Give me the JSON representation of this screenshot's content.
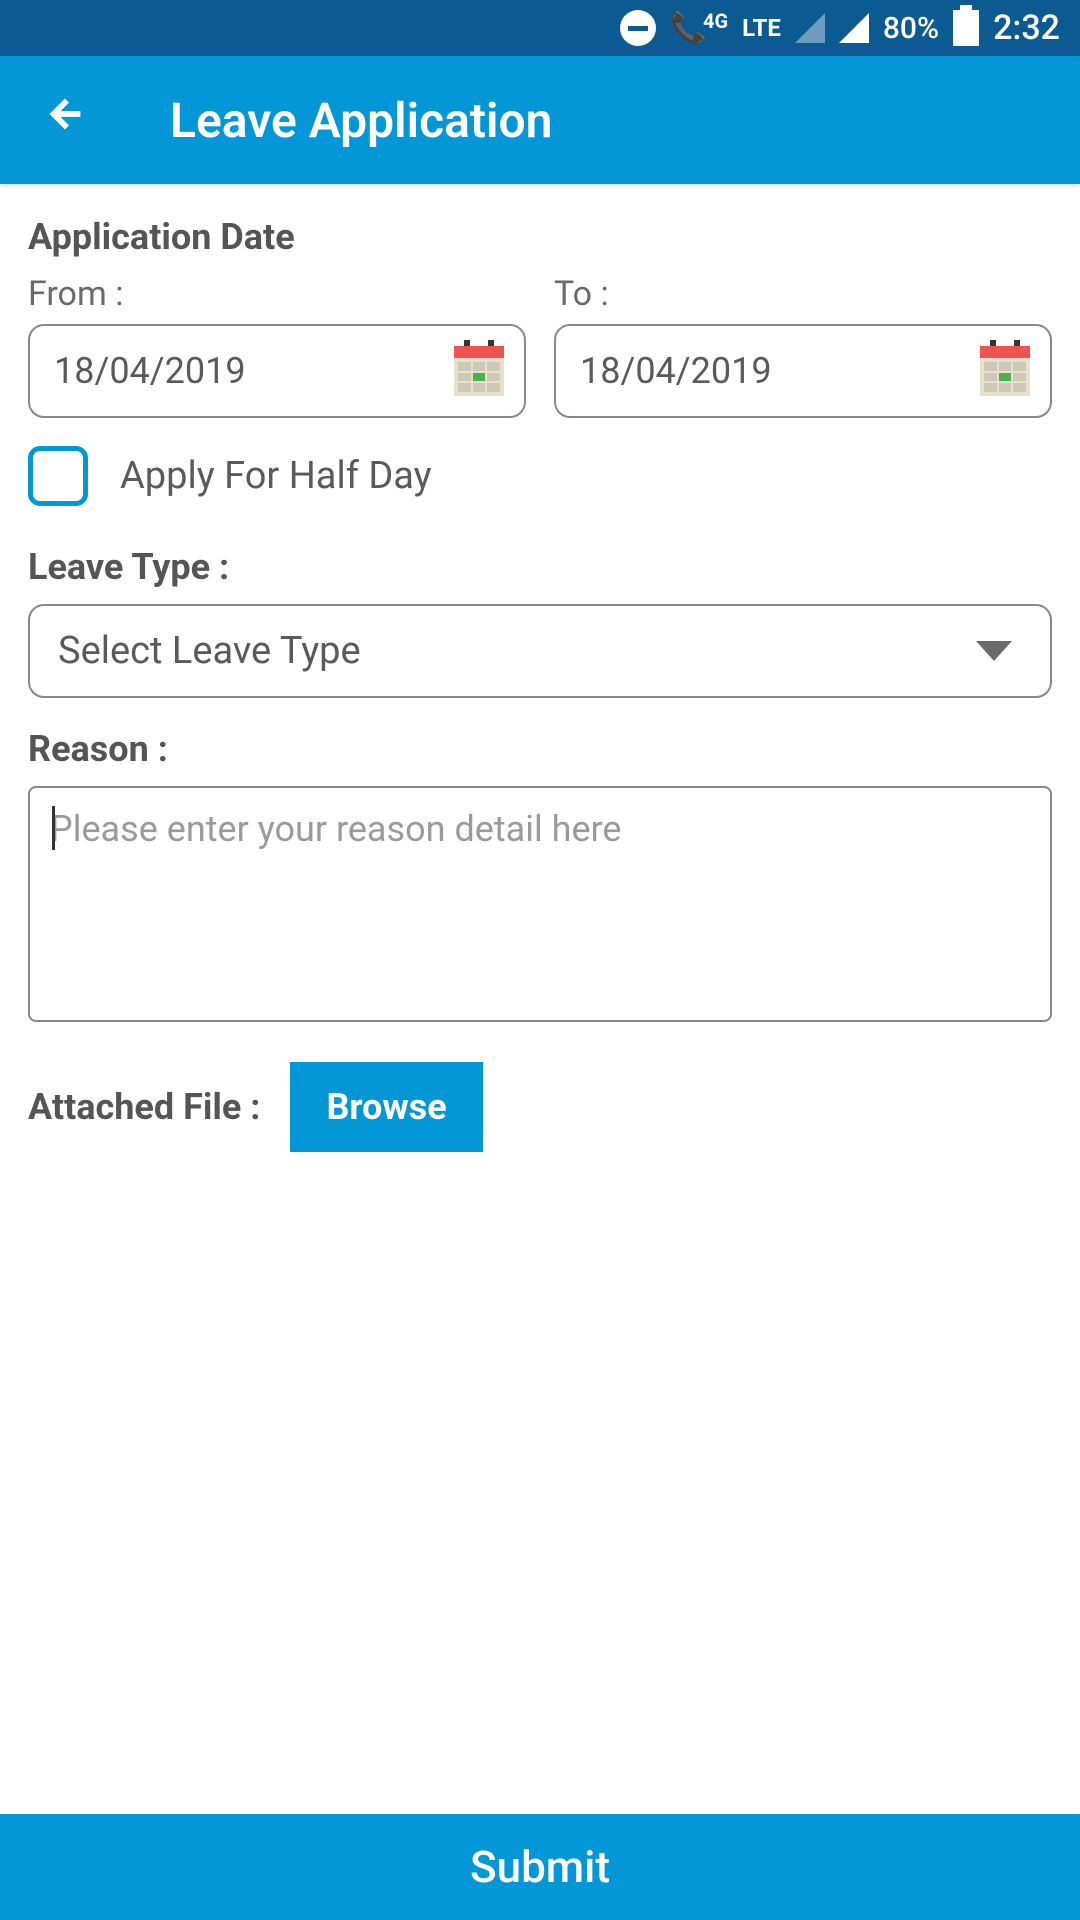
{
  "status_bar": {
    "network_type": "4G",
    "lte": "LTE",
    "battery_percent": "80%",
    "time": "2:32"
  },
  "header": {
    "title": "Leave Application"
  },
  "form": {
    "application_date_label": "Application Date",
    "from_label": "From :",
    "to_label": "To :",
    "from_date": "18/04/2019",
    "to_date": "18/04/2019",
    "half_day_label": "Apply For Half Day",
    "leave_type_label": "Leave Type :",
    "leave_type_placeholder": "Select Leave Type",
    "reason_label": "Reason :",
    "reason_placeholder": "Please enter your reason detail here",
    "attached_file_label": "Attached File :",
    "browse_button": "Browse",
    "submit_button": "Submit"
  }
}
